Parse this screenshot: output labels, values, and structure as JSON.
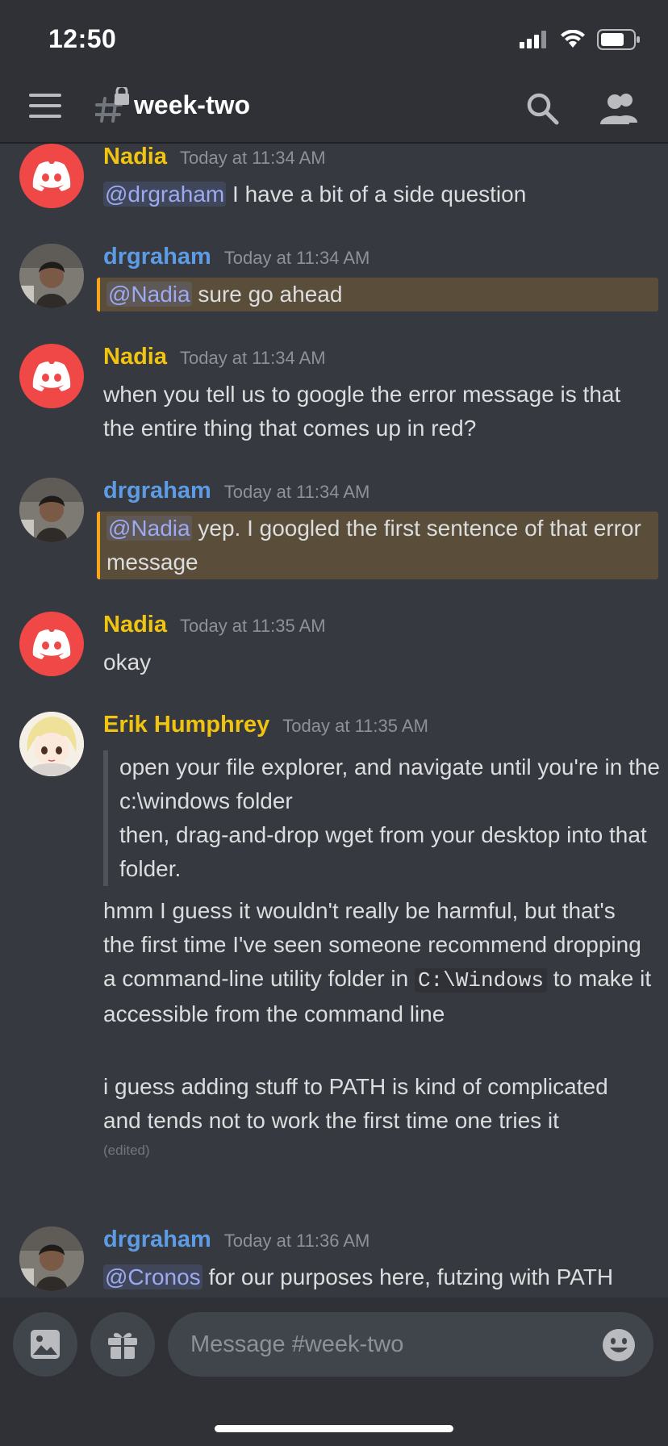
{
  "status_bar": {
    "time": "12:50"
  },
  "header": {
    "channel_name": "week-two",
    "icons": [
      "menu-icon",
      "locked-channel-icon",
      "search-icon",
      "members-icon"
    ]
  },
  "messages": [
    {
      "author": "Nadia",
      "time": "Today at 11:34 AM",
      "mention": "@drgraham",
      "text": " I have a bit of a side question"
    },
    {
      "author": "drgraham",
      "time": "Today at 11:34 AM",
      "mention": "@Nadia",
      "text": " sure go ahead"
    },
    {
      "author": "Nadia",
      "time": "Today at 11:34 AM",
      "text": "when you tell us to google the error message is that the entire thing that comes up in red?"
    },
    {
      "author": "drgraham",
      "time": "Today at 11:34 AM",
      "mention": "@Nadia",
      "text": " yep. I googled the first sentence of that error message"
    },
    {
      "author": "Nadia",
      "time": "Today at 11:35 AM",
      "text": "okay"
    },
    {
      "author": "Erik Humphrey",
      "time": "Today at 11:35 AM",
      "quote_line_1": "open your file explorer, and navigate until you're in the c:\\windows folder",
      "quote_line_2": "then, drag-and-drop wget from your desktop into that folder.",
      "text_before_code": "hmm I guess it wouldn't really be harmful, but that's the first time I've seen someone recommend dropping a command-line utility folder in ",
      "code": "C:\\Windows",
      "text_after_code": " to make it accessible from the command line",
      "followup": "i guess adding stuff to PATH is kind of complicated and tends not to work the first time one tries it",
      "edited": "(edited)"
    },
    {
      "author": "drgraham",
      "time": "Today at 11:36 AM",
      "mention": "@Cronos",
      "text": " for our purposes here, futzing with PATH variables is the road to perdition"
    }
  ],
  "composer": {
    "placeholder": "Message #week-two"
  },
  "colors": {
    "background": "#36393f",
    "nadia": "#f1c40f",
    "drgraham": "#5d9ce5",
    "mention_highlight": "#5a4e3a",
    "mention_bar": "#faa61a"
  }
}
